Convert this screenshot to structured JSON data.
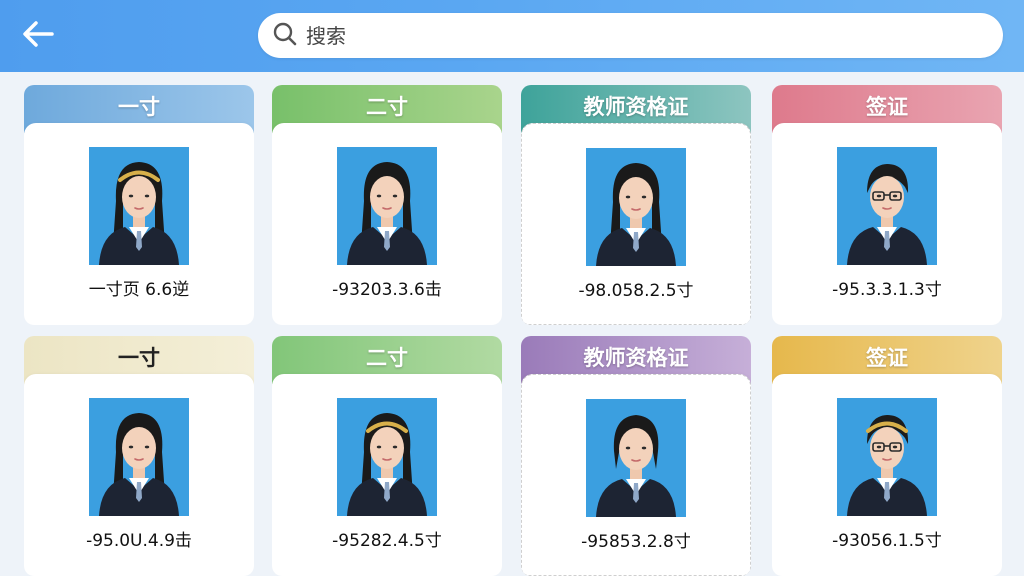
{
  "search": {
    "placeholder": "搜索"
  },
  "cards": [
    {
      "title": "一寸",
      "size": "一寸页 6.6逆",
      "header_color": "#6ea9dc",
      "header_color2": "#9cc6ea",
      "title_style": "light",
      "dashed": false,
      "person": "woman-headband"
    },
    {
      "title": "二寸",
      "size": "-93203.3.6击",
      "header_color": "#78c06a",
      "header_color2": "#a9d48c",
      "title_style": "light",
      "dashed": false,
      "person": "woman"
    },
    {
      "title": "教师资格证",
      "size": "-98.058.2.5寸",
      "header_color": "#3ea39a",
      "header_color2": "#8dc5c0",
      "title_style": "light",
      "dashed": true,
      "person": "woman"
    },
    {
      "title": "签证",
      "size": "-95.3.3.1.3寸",
      "header_color": "#de7a8c",
      "header_color2": "#e9a4b1",
      "title_style": "light",
      "dashed": false,
      "person": "man-glasses"
    },
    {
      "title": "一寸",
      "size": "-95.0U.4.9击",
      "header_color": "#ece5c4",
      "header_color2": "#f4efd8",
      "title_style": "dark",
      "dashed": false,
      "person": "woman-long"
    },
    {
      "title": "二寸",
      "size": "-95282.4.5寸",
      "header_color": "#82c679",
      "header_color2": "#b1daa2",
      "title_style": "light",
      "dashed": false,
      "person": "woman-headband"
    },
    {
      "title": "教师资格证",
      "size": "-95853.2.8寸",
      "header_color": "#9a7bb9",
      "header_color2": "#c6afd8",
      "title_style": "light",
      "dashed": true,
      "person": "woman-short"
    },
    {
      "title": "签证",
      "size": "-93056.1.5寸",
      "header_color": "#e6b84c",
      "header_color2": "#efd38c",
      "title_style": "light",
      "dashed": false,
      "person": "man-headband-glasses"
    }
  ]
}
